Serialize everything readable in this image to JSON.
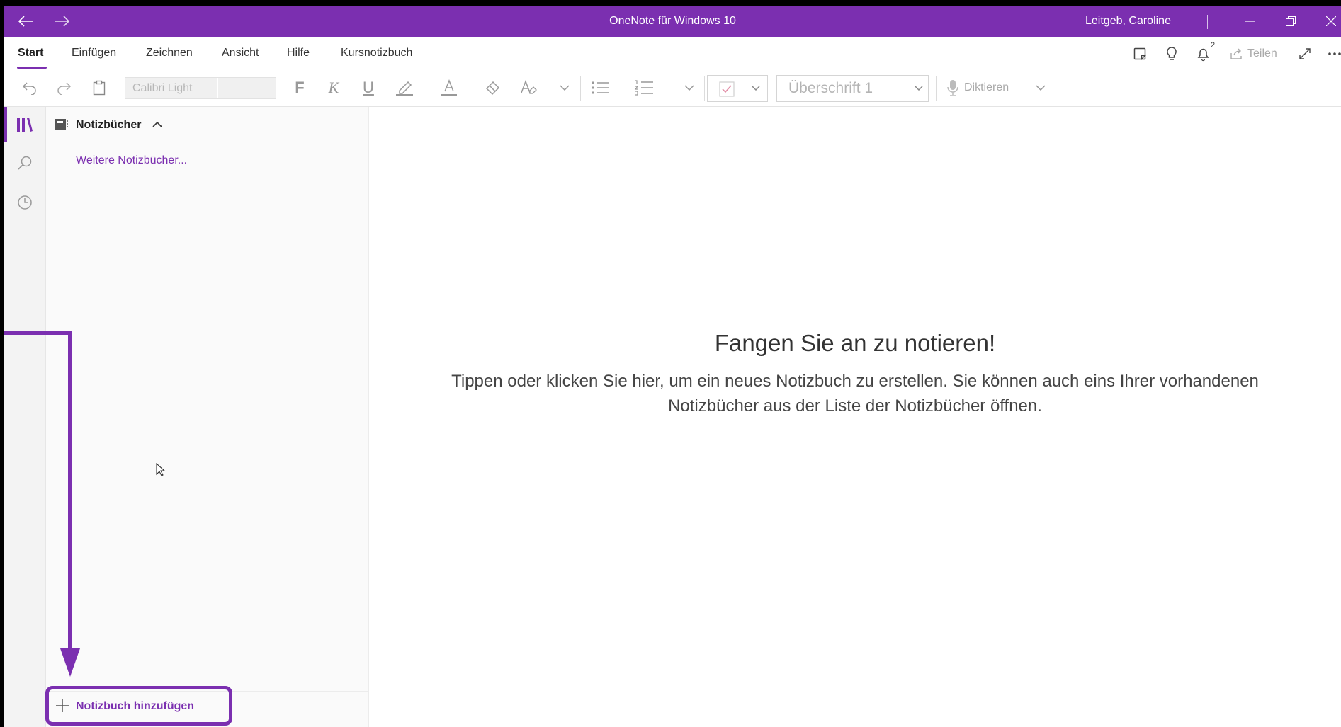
{
  "window": {
    "title": "OneNote für Windows 10",
    "user": "Leitgeb, Caroline",
    "accent_color": "#7b2fb0"
  },
  "ribbon": {
    "tabs": [
      {
        "label": "Start",
        "active": true
      },
      {
        "label": "Einfügen"
      },
      {
        "label": "Zeichnen"
      },
      {
        "label": "Ansicht"
      },
      {
        "label": "Hilfe"
      },
      {
        "label": "Kursnotizbuch"
      }
    ],
    "share_label": "Teilen",
    "notification_count": "2"
  },
  "toolbar": {
    "font_name": "Calibri Light",
    "style_value": "Überschrift 1",
    "dictate_label": "Diktieren",
    "bold_glyph": "F",
    "italic_glyph": "K",
    "underline_glyph": "U"
  },
  "panel": {
    "title": "Notizbücher",
    "more_notebooks": "Weitere Notizbücher...",
    "add_notebook": "Notizbuch hinzufügen"
  },
  "main": {
    "heading": "Fangen Sie an zu notieren!",
    "body": "Tippen oder klicken Sie hier, um ein neues Notizbuch zu erstellen. Sie können auch eins Ihrer vorhandenen Notizbücher aus der Liste der Notizbücher öffnen."
  }
}
